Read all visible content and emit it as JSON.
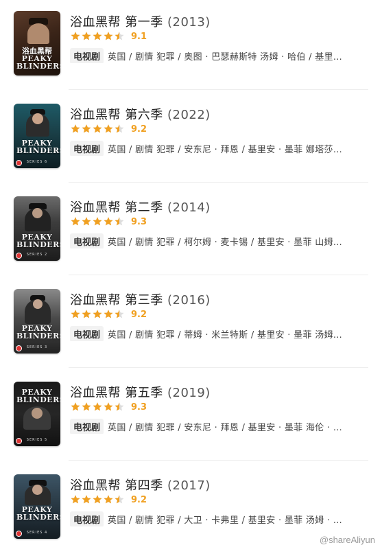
{
  "colors": {
    "star_fill": "#f0a021",
    "star_empty": "#dddddd",
    "score": "#f0a021",
    "tag_bg": "#f2f2f2"
  },
  "items": [
    {
      "title": "浴血黑帮 第一季",
      "year": "(2013)",
      "stars": 4.5,
      "score": "9.1",
      "type": "电视剧",
      "info": "英国 / 剧情 犯罪 / 奥图 · 巴瑟赫斯特 汤姆 · 哈伯 / 基里…",
      "poster": {
        "icon": "poster-image",
        "logo": "浴血黑帮",
        "sub": "PEAKY BLINDERS"
      }
    },
    {
      "title": "浴血黑帮 第六季",
      "year": "(2022)",
      "stars": 4.5,
      "score": "9.2",
      "type": "电视剧",
      "info": "英国 / 剧情 犯罪 / 安东尼 · 拜恩 / 基里安 · 墨菲 娜塔莎…",
      "poster": {
        "icon": "poster-image",
        "logo": "PEAKY BLINDERS",
        "sub": "SERIES 6"
      }
    },
    {
      "title": "浴血黑帮 第二季",
      "year": "(2014)",
      "stars": 4.5,
      "score": "9.3",
      "type": "电视剧",
      "info": "英国 / 剧情 犯罪 / 柯尔姆 · 麦卡锡 / 基里安 · 墨菲 山姆…",
      "poster": {
        "icon": "poster-image",
        "logo": "PEAKY BLINDERS",
        "sub": "SERIES 2"
      }
    },
    {
      "title": "浴血黑帮 第三季",
      "year": "(2016)",
      "stars": 4.5,
      "score": "9.2",
      "type": "电视剧",
      "info": "英国 / 剧情 犯罪 / 蒂姆 · 米兰特斯 / 基里安 · 墨菲 汤姆…",
      "poster": {
        "icon": "poster-image",
        "logo": "PEAKY BLINDERS",
        "sub": "SERIES 3"
      }
    },
    {
      "title": "浴血黑帮 第五季",
      "year": "(2019)",
      "stars": 4.5,
      "score": "9.3",
      "type": "电视剧",
      "info": "英国 / 剧情 犯罪 / 安东尼 · 拜恩 / 基里安 · 墨菲 海伦 · …",
      "poster": {
        "icon": "poster-image",
        "logo": "PEAKY BLINDERS",
        "sub": "SERIES 5"
      }
    },
    {
      "title": "浴血黑帮 第四季",
      "year": "(2017)",
      "stars": 4.5,
      "score": "9.2",
      "type": "电视剧",
      "info": "英国 / 剧情 犯罪 / 大卫 · 卡弗里 / 基里安 · 墨菲 汤姆 · …",
      "poster": {
        "icon": "poster-image",
        "logo": "PEAKY BLINDERS",
        "sub": "SERIES 4"
      }
    }
  ],
  "watermark": "@shareAliyun"
}
